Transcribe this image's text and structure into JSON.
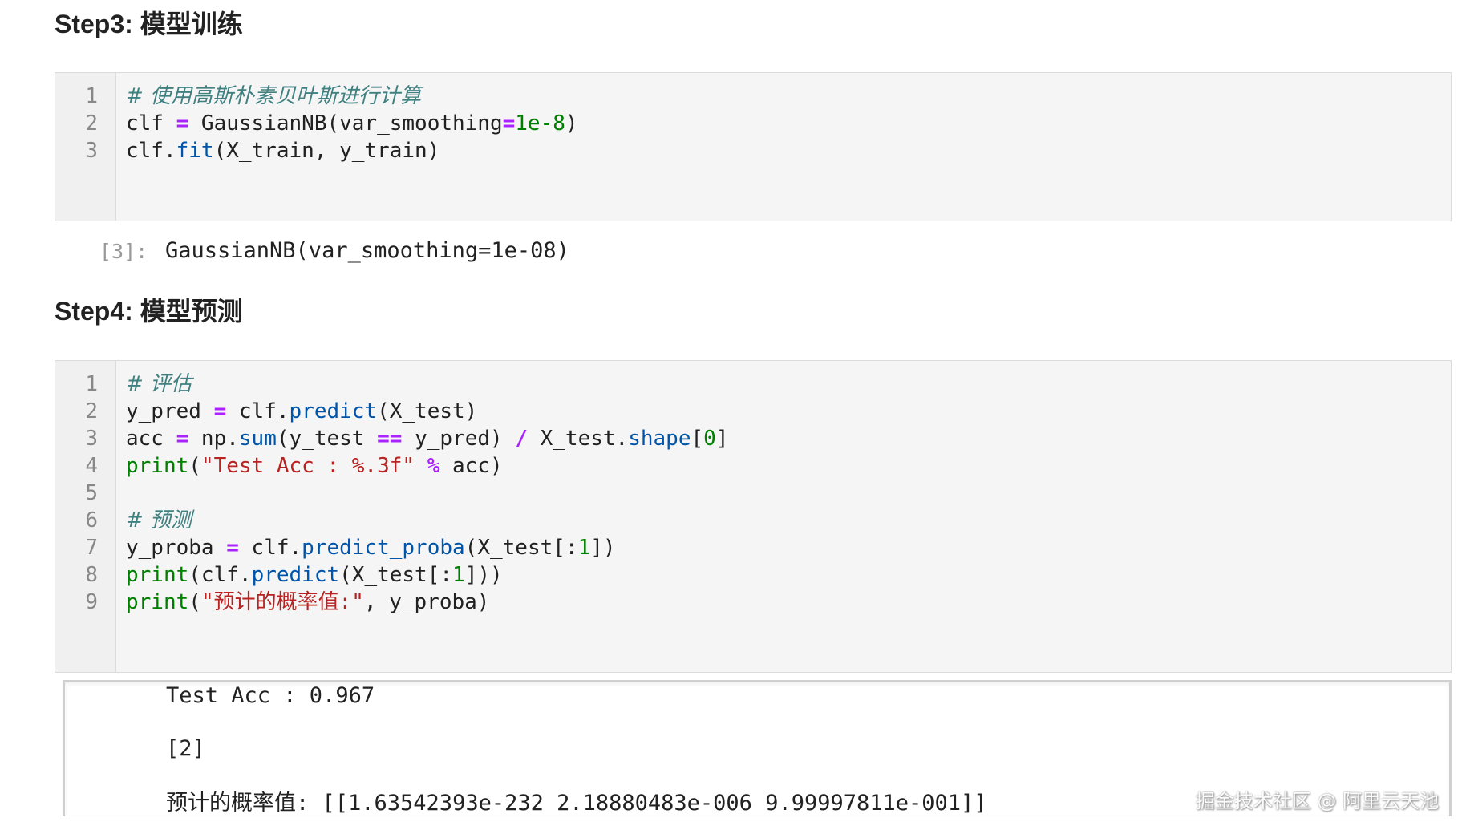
{
  "step3": {
    "title": "Step3: 模型训练",
    "line_numbers": [
      "1",
      "2",
      "3"
    ],
    "code": {
      "l1_comment": "# 使用高斯朴素贝叶斯进行计算",
      "l2_a": "clf ",
      "l2_op": "=",
      "l2_b": " GaussianNB(var_smoothing",
      "l2_op2": "=",
      "l2_num": "1e-8",
      "l2_c": ")",
      "l3_a": "clf.",
      "l3_attr": "fit",
      "l3_b": "(X_train, y_train)"
    },
    "output_prompt": "[3]:",
    "output_value": "GaussianNB(var_smoothing=1e-08)"
  },
  "step4": {
    "title": "Step4: 模型预测",
    "line_numbers": [
      "1",
      "2",
      "3",
      "4",
      "5",
      "6",
      "7",
      "8",
      "9"
    ],
    "code": {
      "l1_comment": "# 评估",
      "l2_a": "y_pred ",
      "l2_op": "=",
      "l2_b": " clf.",
      "l2_attr": "predict",
      "l2_c": "(X_test)",
      "l3_a": "acc ",
      "l3_op": "=",
      "l3_b": " np.",
      "l3_attr": "sum",
      "l3_c": "(y_test ",
      "l3_op2": "==",
      "l3_d": " y_pred) ",
      "l3_op3": "/",
      "l3_e": " X_test.",
      "l3_attr2": "shape",
      "l3_f": "[",
      "l3_num": "0",
      "l3_g": "]",
      "l4_builtin": "print",
      "l4_a": "(",
      "l4_str": "\"Test Acc : %.3f\"",
      "l4_b": " ",
      "l4_op": "%",
      "l4_c": " acc)",
      "l6_comment": "# 预测",
      "l7_a": "y_proba ",
      "l7_op": "=",
      "l7_b": " clf.",
      "l7_attr": "predict_proba",
      "l7_c": "(X_test[:",
      "l7_num": "1",
      "l7_d": "])",
      "l8_builtin": "print",
      "l8_a": "(clf.",
      "l8_attr": "predict",
      "l8_b": "(X_test[:",
      "l8_num": "1",
      "l8_c": "]))",
      "l9_builtin": "print",
      "l9_a": "(",
      "l9_str": "\"预计的概率值:\"",
      "l9_b": ", y_proba)"
    },
    "stdout": [
      "Test Acc : 0.967",
      "[2]",
      "预计的概率值: [[1.63542393e-232 2.18880483e-006 9.99997811e-001]]"
    ]
  },
  "watermark": "掘金技术社区 @ 阿里云天池",
  "colors": {
    "comment": "#408080",
    "operator": "#aa22ff",
    "number": "#008000",
    "attribute": "#0055aa",
    "builtin": "#008000",
    "string": "#ba2121",
    "cell_background": "#f5f5f5"
  }
}
